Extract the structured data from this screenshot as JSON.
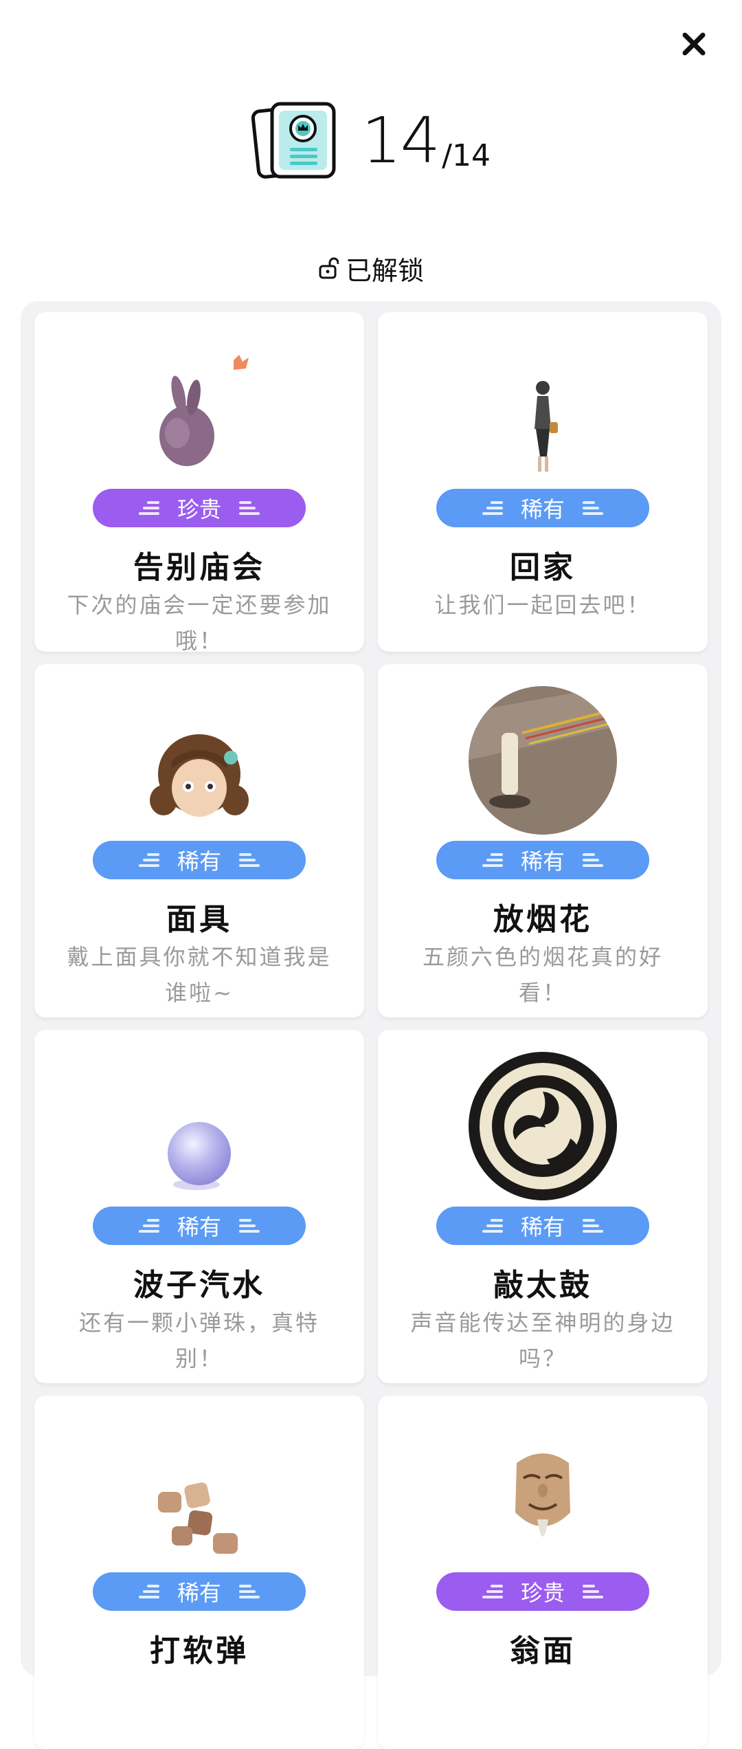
{
  "header": {
    "collected": "14",
    "total": "/14"
  },
  "status": {
    "label": "已解锁"
  },
  "colors": {
    "rare": "#5b9bf5",
    "precious": "#9b5cf0",
    "panel_bg": "#f2f2f4"
  },
  "cards": [
    {
      "name": "告别庙会",
      "rarity": "珍贵",
      "desc": "下次的庙会一定还要参加哦！",
      "icon": "purple-rabbit-toy-icon"
    },
    {
      "name": "回家",
      "rarity": "稀有",
      "desc": "让我们一起回去吧！",
      "icon": "walking-person-icon"
    },
    {
      "name": "面具",
      "rarity": "稀有",
      "desc": "戴上面具你就不知道我是谁啦~",
      "icon": "doll-mask-icon"
    },
    {
      "name": "放烟花",
      "rarity": "稀有",
      "desc": "五颜六色的烟花真的好看！",
      "icon": "sparkler-candle-icon"
    },
    {
      "name": "波子汽水",
      "rarity": "稀有",
      "desc": "还有一颗小弹珠，真特别！",
      "icon": "marble-icon"
    },
    {
      "name": "敲太鼓",
      "rarity": "稀有",
      "desc": "声音能传达至神明的身边吗？",
      "icon": "taiko-drum-icon"
    },
    {
      "name": "打软弹",
      "rarity": "稀有",
      "desc": "",
      "icon": "cork-bullets-icon"
    },
    {
      "name": "翁面",
      "rarity": "珍贵",
      "desc": "",
      "icon": "okina-mask-icon"
    }
  ]
}
